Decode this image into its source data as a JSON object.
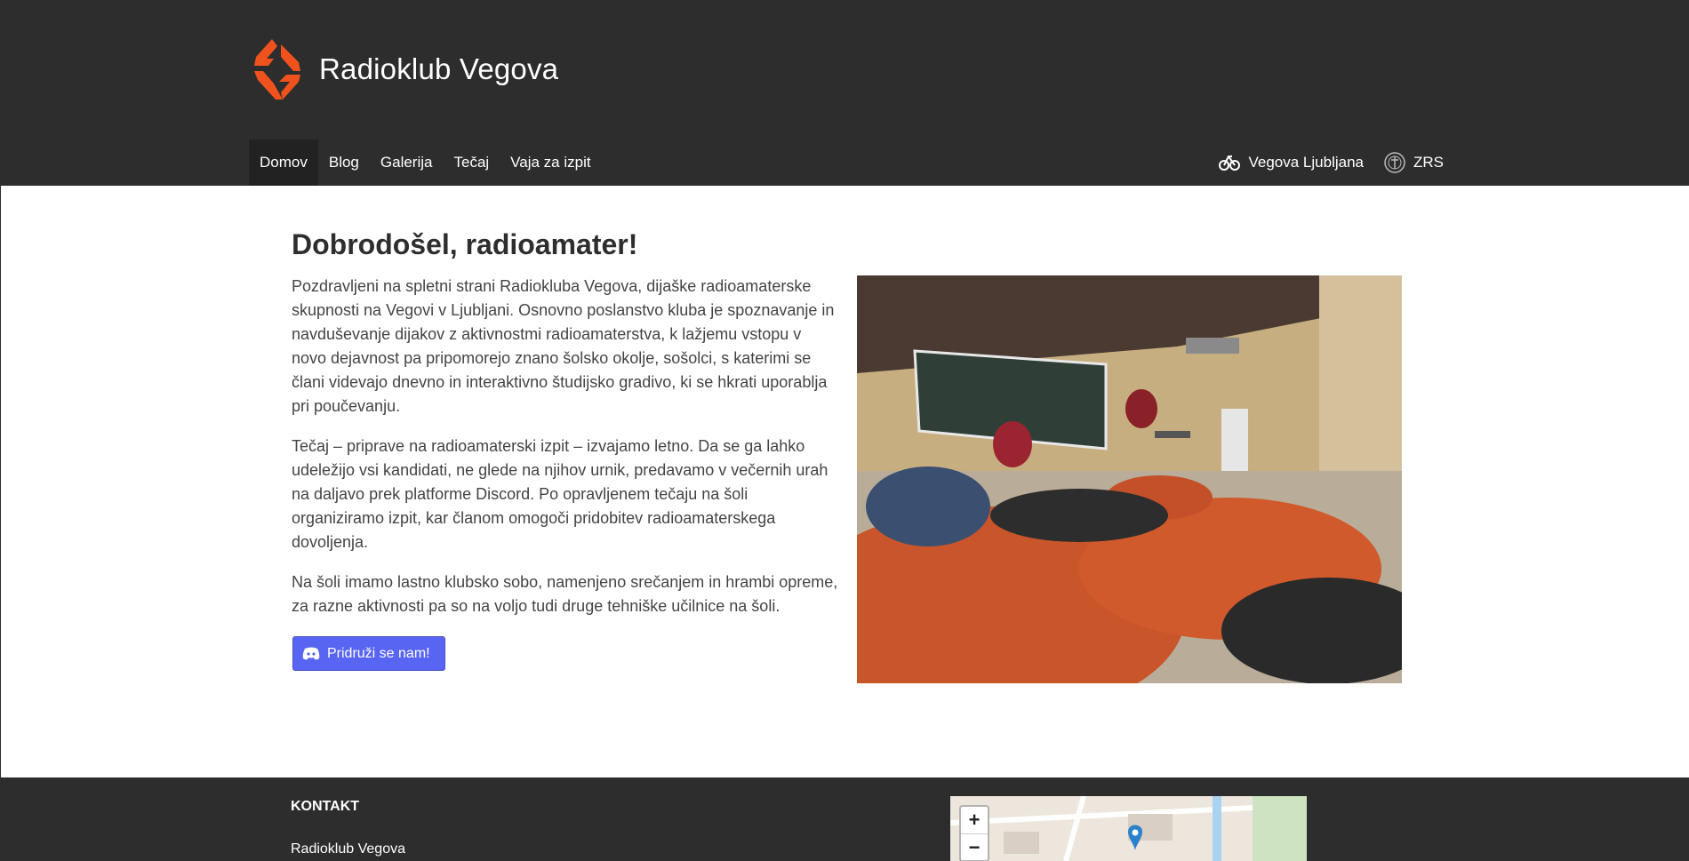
{
  "site": {
    "title": "Radioklub Vegova",
    "logo_icon": "radioklub-logo-icon",
    "accent_color": "#f0521e"
  },
  "nav": {
    "items": [
      {
        "label": "Domov",
        "active": true
      },
      {
        "label": "Blog",
        "active": false
      },
      {
        "label": "Galerija",
        "active": false
      },
      {
        "label": "Tečaj",
        "active": false
      },
      {
        "label": "Vaja za izpit",
        "active": false
      }
    ],
    "external": [
      {
        "label": "Vegova Ljubljana",
        "icon": "vegova-logo-icon"
      },
      {
        "label": "ZRS",
        "icon": "zrs-emblem-icon"
      }
    ]
  },
  "main": {
    "heading": "Dobrodošel, radioamater!",
    "paragraphs": [
      "Pozdravljeni na spletni strani Radiokluba Vegova, dijaške radioamaterske skupnosti na Vegovi v Ljubljani. Osnovno poslanstvo kluba je spoznavanje in navduševanje dijakov z aktivnostmi radioamaterstva, k lažjemu vstopu v novo dejavnost pa pripomorejo znano šolsko okolje, sošolci, s katerimi se člani videvajo dnevno in interaktivno študijsko gradivo, ki se hkrati uporablja pri poučevanju.",
      "Tečaj – priprave na radioamaterski izpit – izvajamo letno. Da se ga lahko udeležijo vsi kandidati, ne glede na njihov urnik, predavamo v večernih urah na daljavo prek platforme Discord. Po opravljenem tečaju na šoli organiziramo izpit, kar članom omogoči pridobitev radioamaterskega dovoljenja.",
      "Na šoli imamo lastno klubsko sobo, namenjeno srečanjem in hrambi opreme, za razne aktivnosti pa so na voljo tudi druge tehniške učilnice na šoli."
    ],
    "join_button": {
      "label": "Pridruži se nam!",
      "icon": "discord-icon",
      "color": "#5865f2"
    }
  },
  "footer": {
    "heading": "KONTAKT",
    "name": "Radioklub Vegova",
    "map": {
      "zoom_in": "+",
      "zoom_out": "−"
    }
  }
}
